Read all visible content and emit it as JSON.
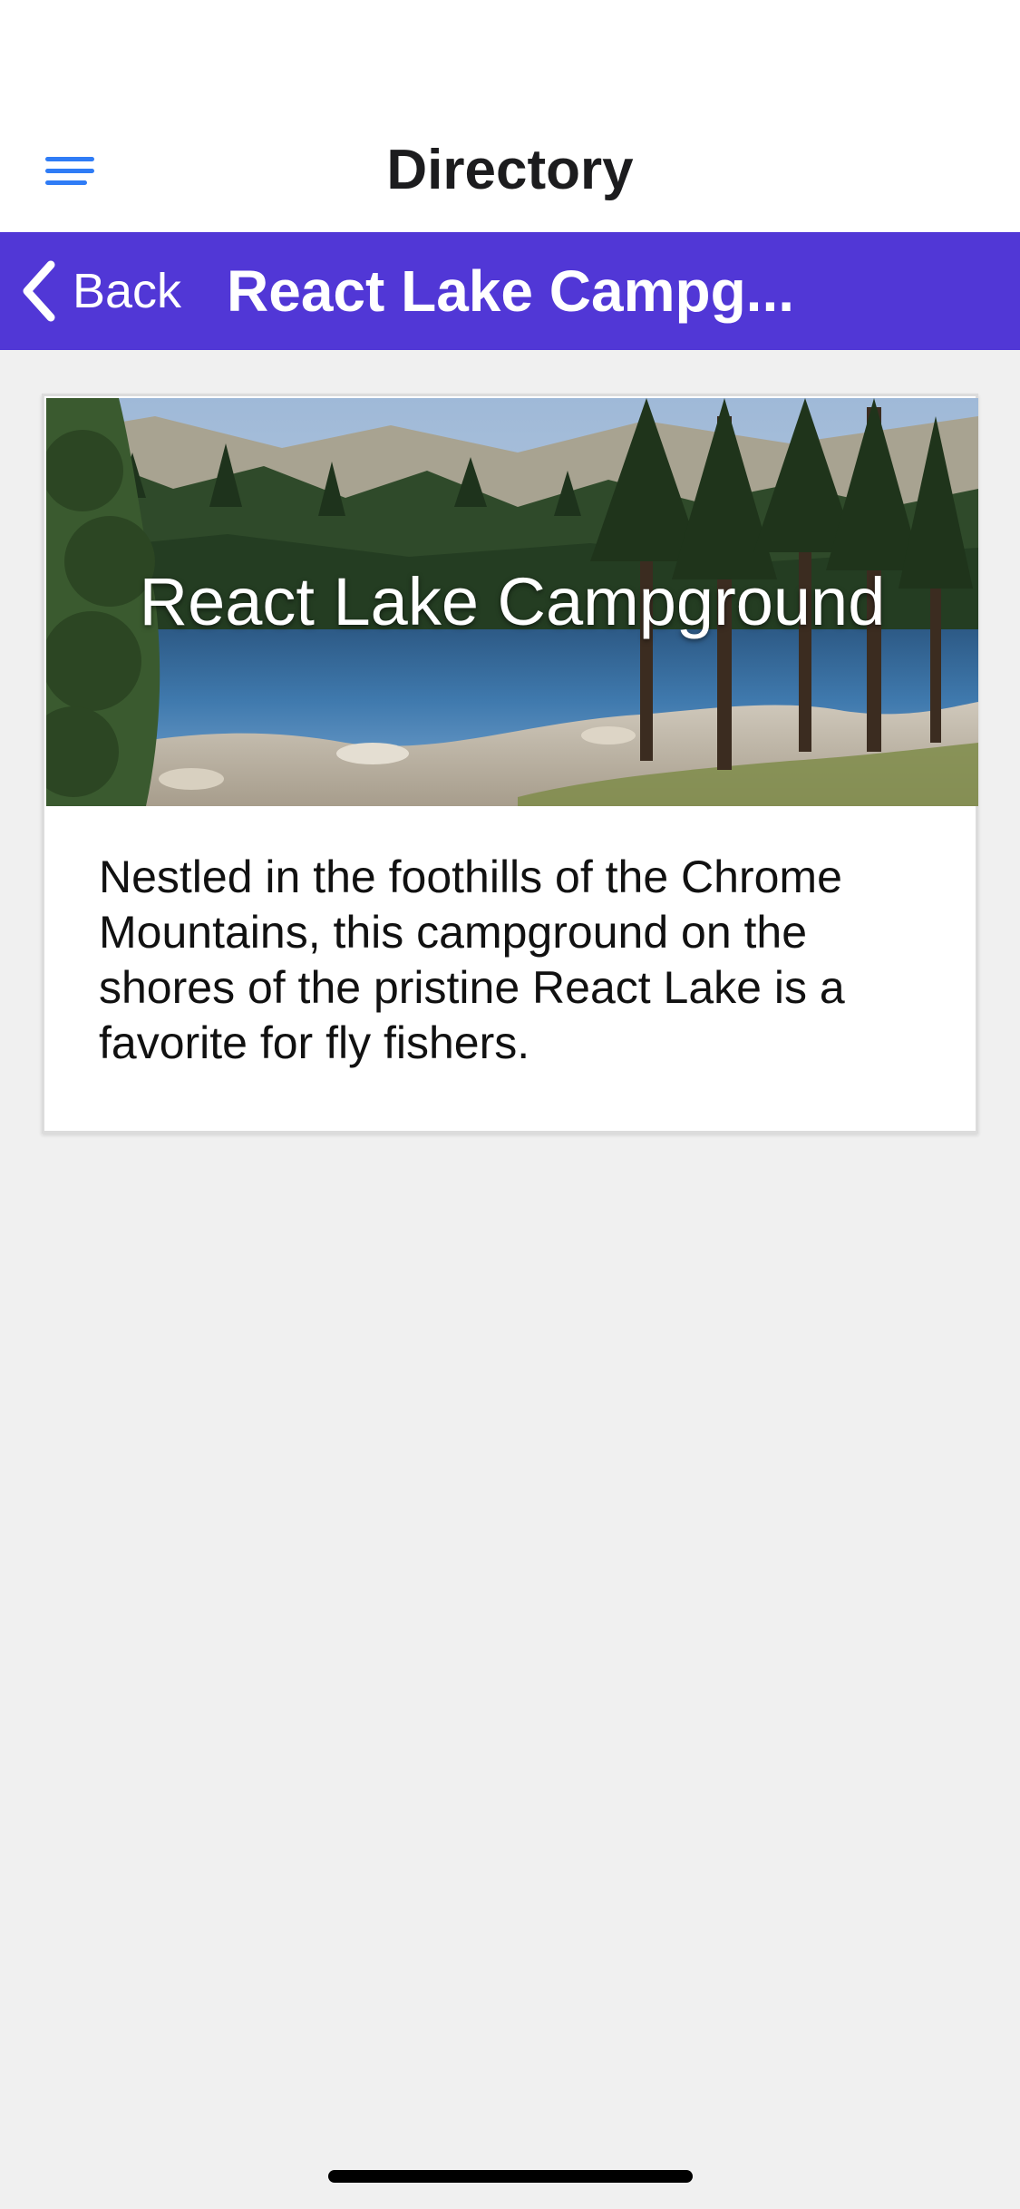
{
  "header": {
    "title": "Directory",
    "menu_icon": "hamburger-menu-icon",
    "accent_color": "#2f7cf6"
  },
  "nav_bar": {
    "back_label": "Back",
    "back_icon": "chevron-left-icon",
    "title": "React Lake Campg...",
    "background_color": "#5137d6"
  },
  "campsite": {
    "image_title": "React Lake Campground",
    "description": "Nestled in the foothills of the Chrome Mountains, this campground on the shores of the pristine React Lake is a favorite for fly fishers."
  }
}
